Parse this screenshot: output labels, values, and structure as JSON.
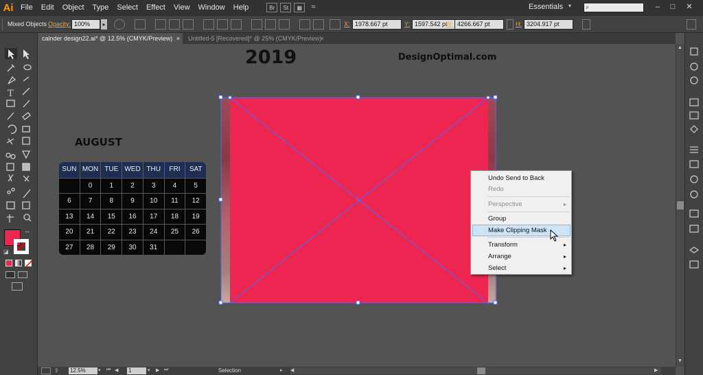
{
  "app": {
    "logo": "Ai"
  },
  "menu": [
    "File",
    "Edit",
    "Object",
    "Type",
    "Select",
    "Effect",
    "View",
    "Window",
    "Help"
  ],
  "menubar_icons": {
    "bridge": "Br",
    "stock": "St"
  },
  "workspace": {
    "label": "Essentials",
    "search_placeholder": ""
  },
  "control_bar": {
    "selection_label": "Mixed Objects",
    "opacity_label": "Opacity:",
    "opacity_value": "100%",
    "x_label": "X:",
    "x_value": "1978.667 pt",
    "y_label": "Y:",
    "y_value": "1597.542 pt",
    "w_label": "W:",
    "w_value": "4266.667 pt",
    "h_label": "H:",
    "h_value": "3204.917 pt"
  },
  "tabs": [
    {
      "label": "calnder design22.ai* @ 12.5% (CMYK/Preview)",
      "close": "×"
    },
    {
      "label": "Untitled-5 [Recovered]* @ 25% (CMYK/Preview)",
      "close": "×"
    }
  ],
  "artboard": {
    "year": "2019",
    "site": "DesignOptimal.com",
    "month": "AUGUST"
  },
  "calendar": {
    "days": [
      "SUN",
      "MON",
      "TUE",
      "WED",
      "THU",
      "FRI",
      "SAT"
    ],
    "weeks": [
      [
        "",
        "0",
        "1",
        "2",
        "3",
        "4",
        "5"
      ],
      [
        "6",
        "7",
        "8",
        "9",
        "10",
        "11",
        "12"
      ],
      [
        "13",
        "14",
        "15",
        "16",
        "17",
        "18",
        "19"
      ],
      [
        "20",
        "21",
        "22",
        "23",
        "24",
        "25",
        "26"
      ],
      [
        "27",
        "28",
        "29",
        "30",
        "31",
        "",
        ""
      ]
    ]
  },
  "context_menu": {
    "undo": "Undo Send to Back",
    "redo": "Redo",
    "perspective": "Perspective",
    "group": "Group",
    "make_clipping_mask": "Make Clipping Mask",
    "transform": "Transform",
    "arrange": "Arrange",
    "select": "Select",
    "arrow": "▸"
  },
  "status_bar": {
    "zoom": "12.5%",
    "artboard_number": "1",
    "tool_name": "Selection"
  },
  "colors": {
    "fill_swatch": "#ed2551",
    "red_rectangle": "#ed2551",
    "calendar_header": "#1d2e52",
    "calendar_cell": "#080808",
    "canvas": "#535353",
    "selection_blue": "#4a6cf7"
  },
  "icons": [
    "selection-tool-icon",
    "direct-selection-icon",
    "magic-wand-icon",
    "lasso-icon",
    "pen-icon",
    "type-icon",
    "line-icon",
    "rectangle-icon",
    "paintbrush-icon",
    "pencil-icon",
    "eraser-icon",
    "rotate-icon",
    "scale-icon",
    "warp-icon",
    "free-transform-icon",
    "shape-builder-icon",
    "perspective-grid-icon",
    "mesh-icon",
    "gradient-icon",
    "eyedropper-icon",
    "blend-icon",
    "symbol-sprayer-icon",
    "column-graph-icon",
    "artboard-icon",
    "slice-icon",
    "hand-icon",
    "zoom-icon",
    "mouse-cursor-icon"
  ]
}
